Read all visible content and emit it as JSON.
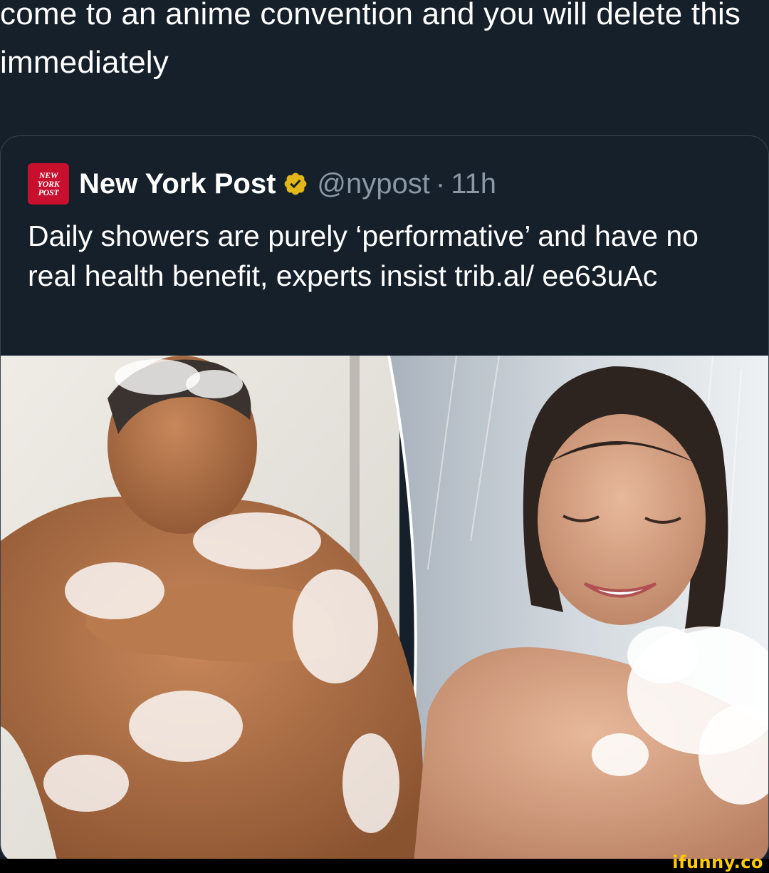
{
  "tweet": {
    "text": "come to an anime convention and you will delete this immediately"
  },
  "quote": {
    "logo_lines": [
      "NEW",
      "YORK",
      "POST"
    ],
    "author": "New York Post",
    "handle": "@nypost",
    "separator": "·",
    "time": "11h",
    "body": "Daily showers are purely ‘performative’ and have no real health benefit, experts insist trib.al/ ee63uAc",
    "verified_color": "#e2b719",
    "logo_color": "#c8102e"
  },
  "media": {
    "icon": "shower-photo"
  },
  "watermark": {
    "text": "ifunny.co",
    "color": "#ffcc00"
  },
  "colors": {
    "background": "#15202b",
    "border": "#38444d",
    "secondary_text": "#8b98a5"
  }
}
